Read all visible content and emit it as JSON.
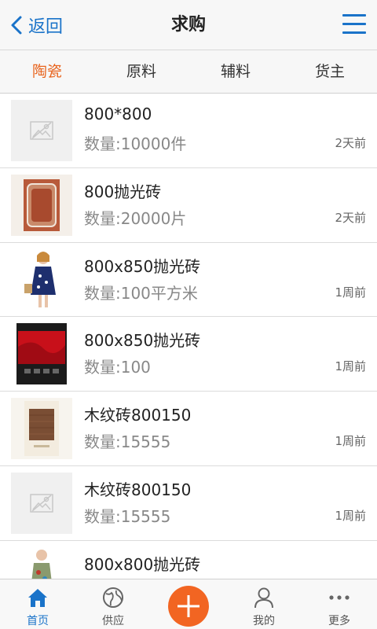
{
  "header": {
    "back_label": "返回",
    "title": "求购"
  },
  "tabs": [
    {
      "label": "陶瓷",
      "active": true
    },
    {
      "label": "原料",
      "active": false
    },
    {
      "label": "辅料",
      "active": false
    },
    {
      "label": "货主",
      "active": false
    }
  ],
  "items": [
    {
      "name": "800*800",
      "qty": "数量:10000件",
      "time": "2天前",
      "thumb": "placeholder-image-icon"
    },
    {
      "name": "800抛光砖",
      "qty": "数量:20000片",
      "time": "2天前",
      "thumb": "tile-photo"
    },
    {
      "name": "800x850抛光砖",
      "qty": "数量:100平方米",
      "time": "1周前",
      "thumb": "fashion-photo"
    },
    {
      "name": "800x850抛光砖",
      "qty": "数量:100",
      "time": "1周前",
      "thumb": "red-fabric-photo"
    },
    {
      "name": "木纹砖800150",
      "qty": "数量:15555",
      "time": "1周前",
      "thumb": "wood-tile-photo"
    },
    {
      "name": "木纹砖800150",
      "qty": "数量:15555",
      "time": "1周前",
      "thumb": "placeholder-image-icon"
    },
    {
      "name": "800x800抛光砖",
      "qty": "",
      "time": "",
      "thumb": "fashion-photo"
    }
  ],
  "tabbar": {
    "home": "首页",
    "supply": "供应",
    "mine": "我的",
    "more": "更多"
  },
  "colors": {
    "accent": "#1a73c9",
    "active_tab": "#e8651f",
    "plus": "#f26522"
  }
}
